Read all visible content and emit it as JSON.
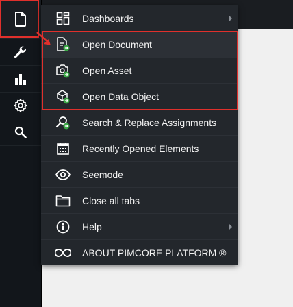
{
  "sidebar": {
    "items": [
      {
        "icon": "file-icon"
      },
      {
        "icon": "wrench-icon"
      },
      {
        "icon": "bar-chart-icon"
      },
      {
        "icon": "gear-icon"
      },
      {
        "icon": "search-icon"
      }
    ]
  },
  "menu": {
    "items": [
      {
        "label": "Dashboards",
        "icon": "dashboard-grid-icon",
        "has_submenu": true
      },
      {
        "label": "Open Document",
        "icon": "open-document-icon"
      },
      {
        "label": "Open Asset",
        "icon": "open-asset-icon"
      },
      {
        "label": "Open Data Object",
        "icon": "open-data-object-icon"
      },
      {
        "label": "Search & Replace Assignments",
        "icon": "search-replace-icon"
      },
      {
        "label": "Recently Opened Elements",
        "icon": "calendar-icon"
      },
      {
        "label": "Seemode",
        "icon": "eye-icon"
      },
      {
        "label": "Close all tabs",
        "icon": "folder-icon"
      },
      {
        "label": "Help",
        "icon": "info-icon",
        "has_submenu": true
      },
      {
        "label": "ABOUT PIMCORE PLATFORM ®",
        "icon": "infinity-icon"
      }
    ]
  },
  "colors": {
    "highlight": "#e0302c",
    "menu_bg": "#23272c",
    "sidebar_bg": "#12161b",
    "accent_green": "#3aa845"
  }
}
